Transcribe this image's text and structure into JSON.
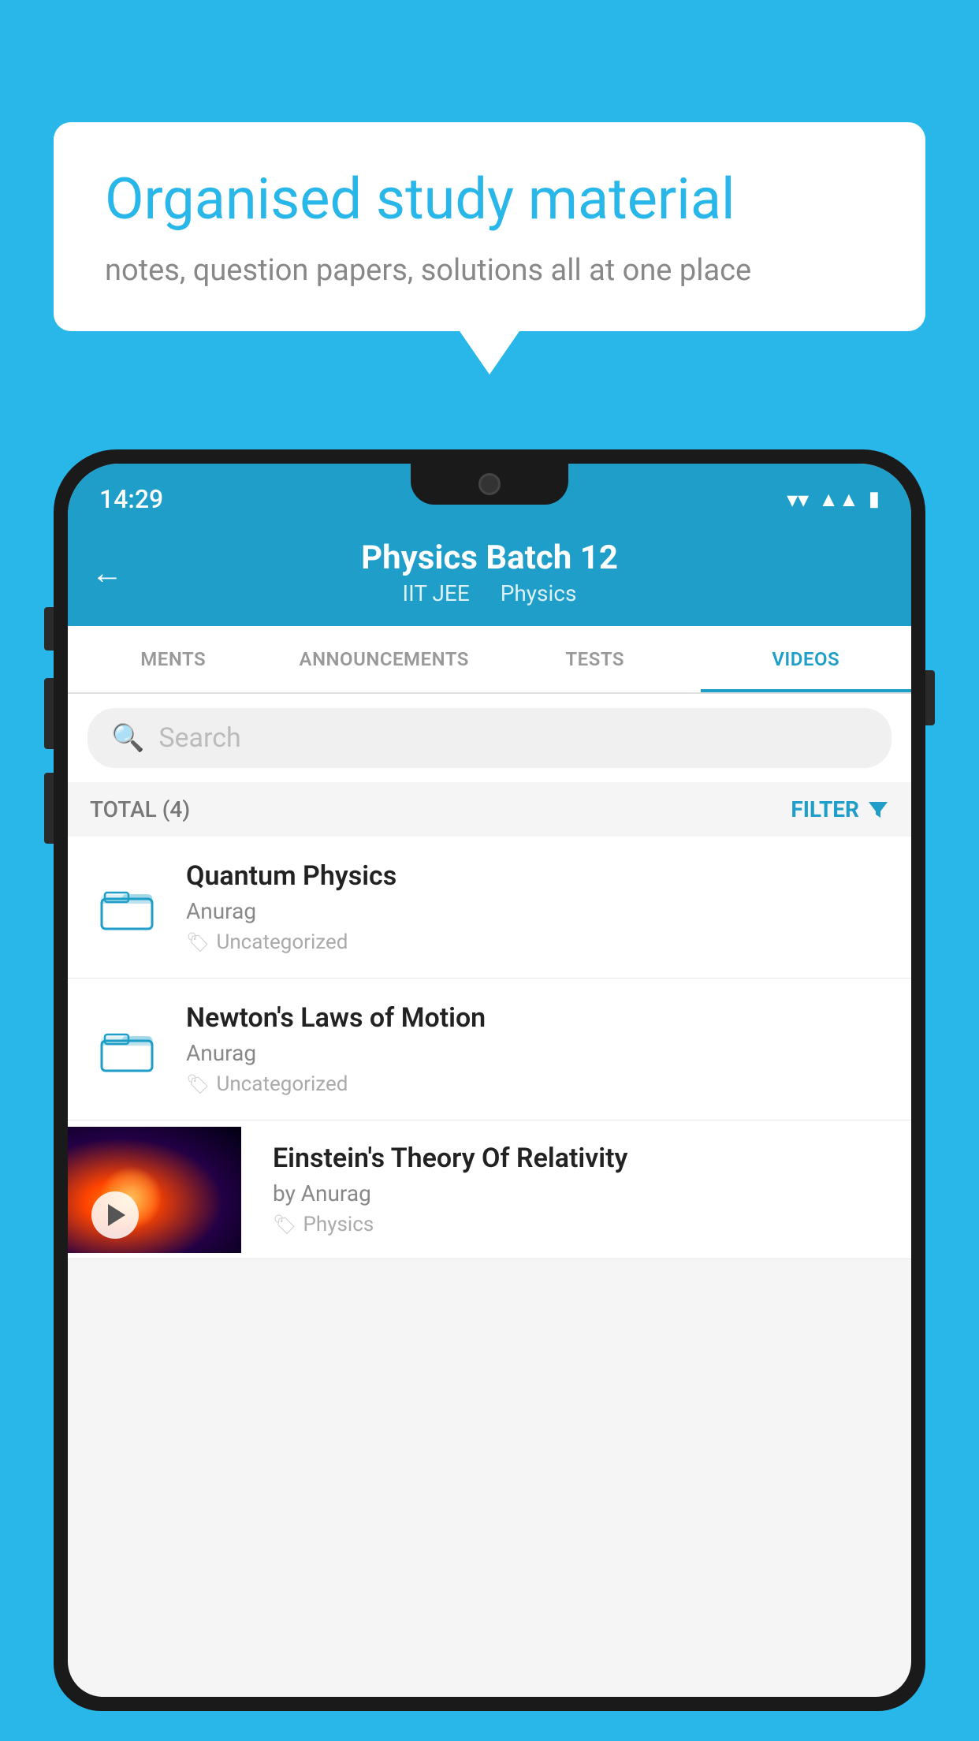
{
  "background_color": "#29B6E8",
  "speech_bubble": {
    "title": "Organised study material",
    "subtitle": "notes, question papers, solutions all at one place"
  },
  "status_bar": {
    "time": "14:29",
    "wifi": "▾",
    "signal": "▲",
    "battery": "▮"
  },
  "header": {
    "title": "Physics Batch 12",
    "subtitle1": "IIT JEE",
    "subtitle2": "Physics",
    "back_label": "←"
  },
  "tabs": [
    {
      "label": "MENTS",
      "active": false
    },
    {
      "label": "ANNOUNCEMENTS",
      "active": false
    },
    {
      "label": "TESTS",
      "active": false
    },
    {
      "label": "VIDEOS",
      "active": true
    }
  ],
  "search": {
    "placeholder": "Search"
  },
  "filter_bar": {
    "total_label": "TOTAL (4)",
    "filter_label": "FILTER"
  },
  "videos": [
    {
      "id": 1,
      "title": "Quantum Physics",
      "author": "Anurag",
      "tag": "Uncategorized",
      "has_thumbnail": false
    },
    {
      "id": 2,
      "title": "Newton's Laws of Motion",
      "author": "Anurag",
      "tag": "Uncategorized",
      "has_thumbnail": false
    },
    {
      "id": 3,
      "title": "Einstein's Theory Of Relativity",
      "author": "by Anurag",
      "tag": "Physics",
      "has_thumbnail": true
    }
  ]
}
